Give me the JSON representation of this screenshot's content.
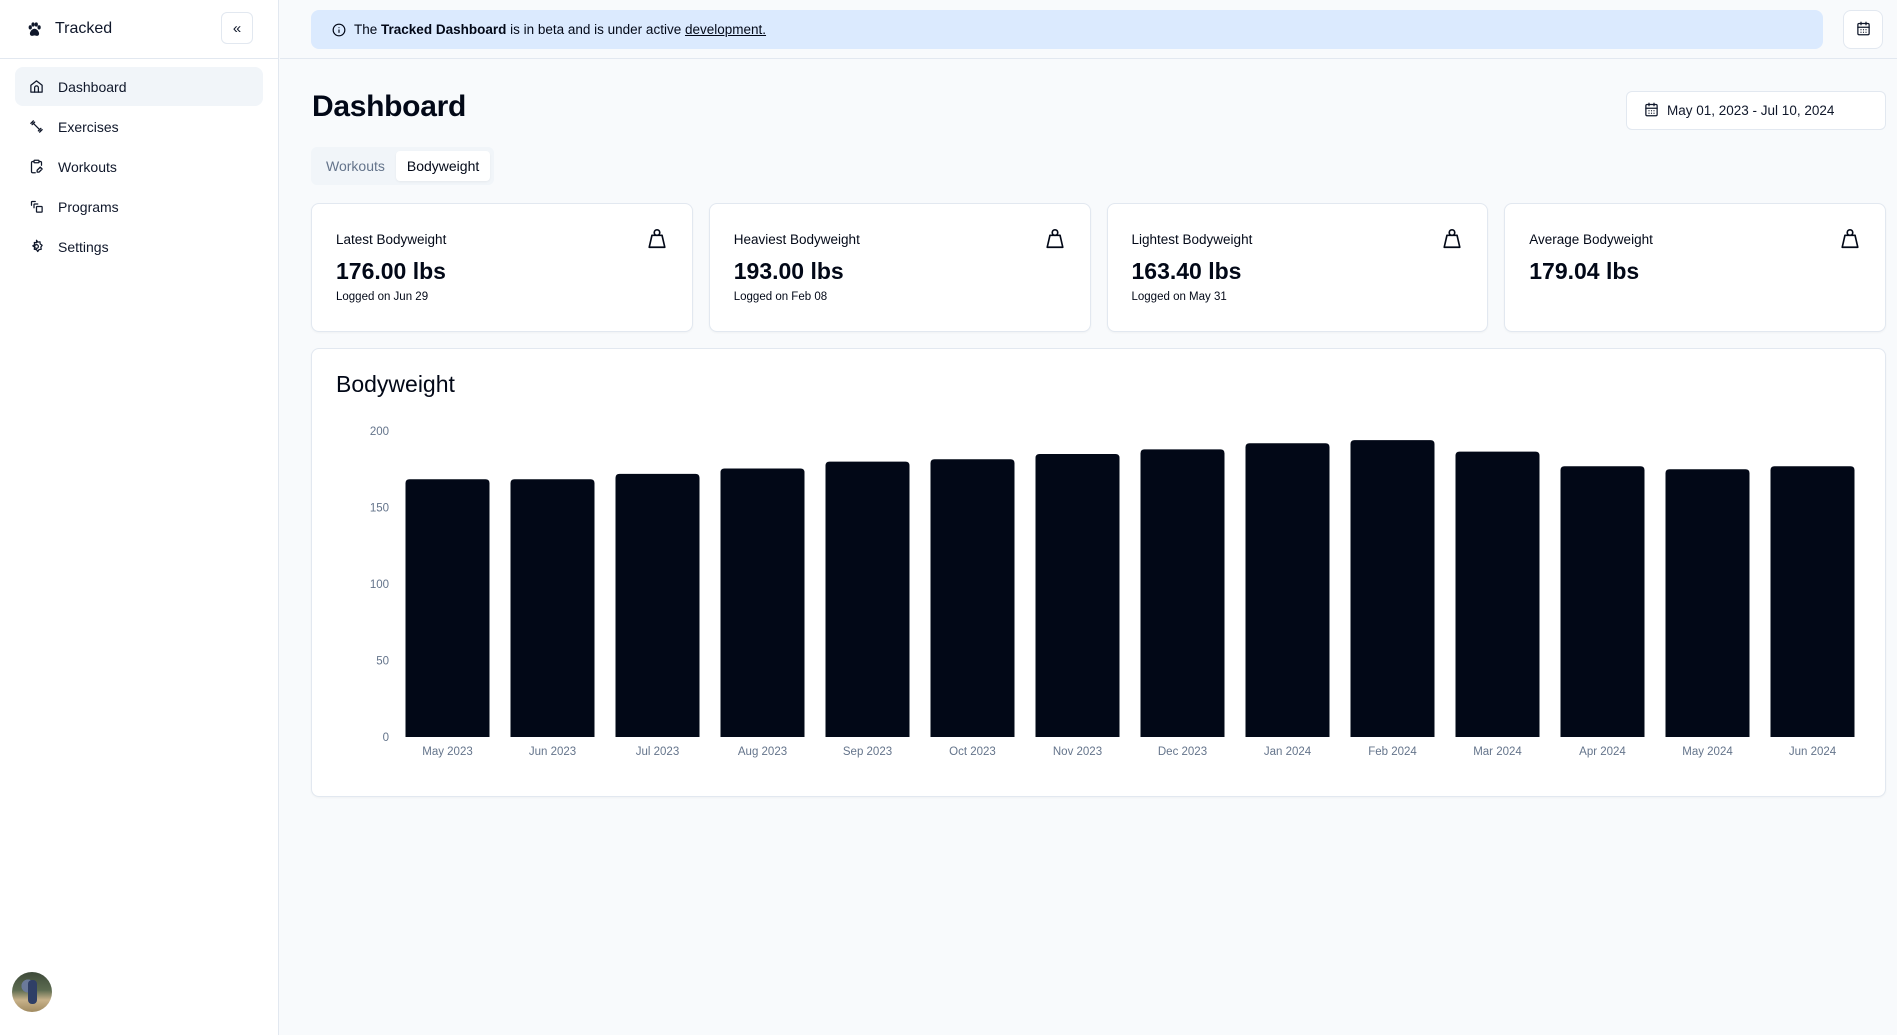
{
  "app": {
    "name": "Tracked",
    "collapse_label": "«"
  },
  "sidebar": {
    "items": [
      {
        "label": "Dashboard",
        "icon": "home-icon",
        "active": true
      },
      {
        "label": "Exercises",
        "icon": "dumbbell-icon",
        "active": false
      },
      {
        "label": "Workouts",
        "icon": "clipboard-edit-icon",
        "active": false
      },
      {
        "label": "Programs",
        "icon": "programs-icon",
        "active": false
      },
      {
        "label": "Settings",
        "icon": "gear-icon",
        "active": false
      }
    ]
  },
  "banner": {
    "prefix": "The",
    "bold": "Tracked Dashboard",
    "middle": "is in beta and is under active",
    "link": "development."
  },
  "page": {
    "title": "Dashboard",
    "date_range": "May 01, 2023 - Jul 10, 2024",
    "tabs": [
      {
        "label": "Workouts",
        "active": false
      },
      {
        "label": "Bodyweight",
        "active": true
      }
    ]
  },
  "stats": [
    {
      "label": "Latest Bodyweight",
      "value": "176.00 lbs",
      "sub": "Logged on Jun 29"
    },
    {
      "label": "Heaviest Bodyweight",
      "value": "193.00 lbs",
      "sub": "Logged on Feb 08"
    },
    {
      "label": "Lightest Bodyweight",
      "value": "163.40 lbs",
      "sub": "Logged on May 31"
    },
    {
      "label": "Average Bodyweight",
      "value": "179.04 lbs",
      "sub": ""
    }
  ],
  "chart_data": {
    "type": "bar",
    "title": "Bodyweight",
    "xlabel": "",
    "ylabel": "",
    "categories": [
      "May 2023",
      "Jun 2023",
      "Jul 2023",
      "Aug 2023",
      "Sep 2023",
      "Oct 2023",
      "Nov 2023",
      "Dec 2023",
      "Jan 2024",
      "Feb 2024",
      "Mar 2024",
      "Apr 2024",
      "May 2024",
      "Jun 2024"
    ],
    "values": [
      168.5,
      168.5,
      172,
      175.5,
      180,
      181.5,
      185,
      188,
      192,
      194,
      186.5,
      177,
      175,
      177
    ],
    "ylim": [
      0,
      200
    ],
    "yticks": [
      0,
      50,
      100,
      150,
      200
    ],
    "grid": false,
    "bar_color": "#020817"
  }
}
